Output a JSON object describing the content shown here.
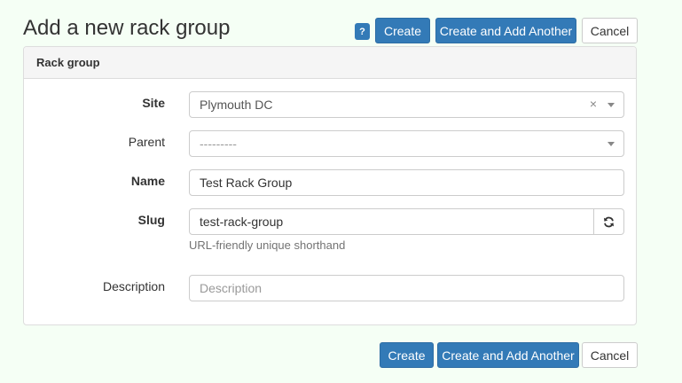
{
  "page": {
    "title": "Add a new rack group"
  },
  "top_actions": {
    "help_label": "?",
    "create_label": "Create",
    "create_add_label": "Create and Add Another",
    "cancel_label": "Cancel"
  },
  "panel": {
    "heading": "Rack group"
  },
  "form": {
    "site": {
      "label": "Site",
      "value": "Plymouth DC",
      "clear": "×"
    },
    "parent": {
      "label": "Parent",
      "value": "---------"
    },
    "name": {
      "label": "Name",
      "value": "Test Rack Group"
    },
    "slug": {
      "label": "Slug",
      "value": "test-rack-group",
      "help": "URL-friendly unique shorthand"
    },
    "description": {
      "label": "Description",
      "placeholder": "Description"
    }
  },
  "bottom_actions": {
    "create_label": "Create",
    "create_add_label": "Create and Add Another",
    "cancel_label": "Cancel"
  },
  "colors": {
    "primary": "#337ab7",
    "background": "#f5fff5"
  },
  "icons": {
    "slug_regenerate": "refresh-icon",
    "select_caret": "caret-down-icon"
  }
}
